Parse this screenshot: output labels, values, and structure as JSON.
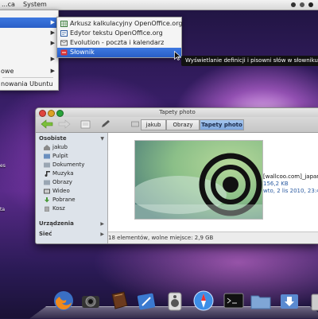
{
  "panel": {
    "menus": [
      "...ca",
      "System"
    ]
  },
  "main_menu": {
    "items": [
      {
        "label": "",
        "has_submenu": true,
        "highlighted": true
      },
      {
        "label": "",
        "has_submenu": true
      },
      {
        "label": "",
        "has_submenu": true
      },
      {
        "label": "",
        "has_submenu": true
      },
      {
        "label": "owe",
        "has_submenu": true
      },
      {
        "label": "nowania Ubuntu",
        "has_submenu": false
      }
    ]
  },
  "submenu": {
    "items": [
      {
        "label": "Arkusz kalkulacyjny OpenOffice.org",
        "icon": "spreadsheet-icon"
      },
      {
        "label": "Edytor tekstu OpenOffice.org",
        "icon": "writer-icon"
      },
      {
        "label": "Evolution - poczta i kalendarz",
        "icon": "mail-calendar-icon"
      },
      {
        "label": "Słownik",
        "icon": "dictionary-icon",
        "selected": true
      }
    ]
  },
  "tooltip": "Wyświetlanie definicji i pisowni słów w słowniku s",
  "desktop_fragments": [
    "es",
    "ta"
  ],
  "window": {
    "title": "Tapety photo",
    "breadcrumbs": [
      "jakub",
      "Obrazy",
      "Tapety photo"
    ],
    "sidebar": {
      "places_header": "Osobiste",
      "places": [
        {
          "label": "jakub",
          "icon": "home-folder-icon"
        },
        {
          "label": "Pulpit",
          "icon": "desktop-folder-icon"
        },
        {
          "label": "Dokumenty",
          "icon": "documents-folder-icon"
        },
        {
          "label": "Muzyka",
          "icon": "music-folder-icon"
        },
        {
          "label": "Obrazy",
          "icon": "pictures-folder-icon"
        },
        {
          "label": "Wideo",
          "icon": "videos-folder-icon"
        },
        {
          "label": "Pobrane",
          "icon": "downloads-folder-icon"
        },
        {
          "label": "Kosz",
          "icon": "trash-icon"
        }
      ],
      "devices_header": "Urządzenia",
      "network_header": "Sieć"
    },
    "file": {
      "name": "[wallcoo.com]_japane",
      "size": "156,2 KB",
      "date": "wto, 2 lis 2010, 23:4("
    },
    "status": "18 elementów, wolne miejsce: 2,9 GB"
  },
  "dock": {
    "icons": [
      "firefox-icon",
      "camera-icon",
      "book-icon",
      "pen-icon",
      "speaker-icon",
      "safari-icon",
      "folder-icon",
      "terminal-icon",
      "finder-icon",
      "downloads-icon",
      "trash-icon"
    ]
  },
  "colors": {
    "highlight": "#2f66d0",
    "window_bg": "#ececec",
    "sidebar_bg": "#dde3ea"
  }
}
